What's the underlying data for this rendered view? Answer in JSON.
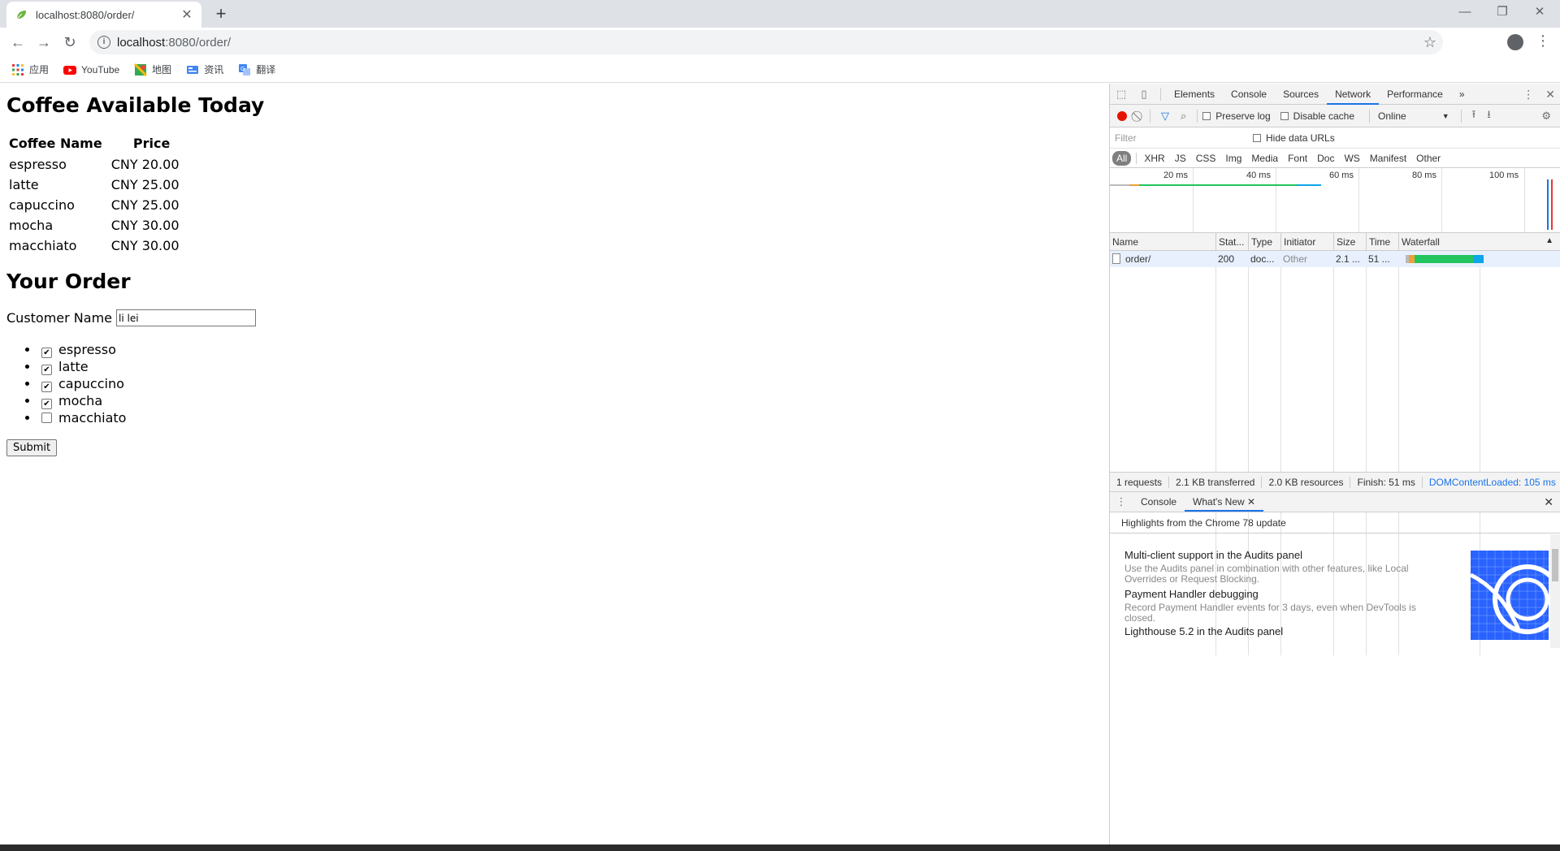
{
  "browser": {
    "tab_title": "localhost:8080/order/",
    "new_tab": "+",
    "url_host": "localhost",
    "url_path": ":8080/order/",
    "bookmarks": [
      {
        "label": "应用",
        "icon": "apps-grid-icon"
      },
      {
        "label": "YouTube",
        "icon": "youtube-icon"
      },
      {
        "label": "地图",
        "icon": "maps-icon"
      },
      {
        "label": "资讯",
        "icon": "news-icon"
      },
      {
        "label": "翻译",
        "icon": "translate-icon"
      }
    ]
  },
  "page": {
    "heading": "Coffee Available Today",
    "table_headers": [
      "Coffee Name",
      "Price"
    ],
    "coffees": [
      {
        "name": "espresso",
        "price": "CNY 20.00"
      },
      {
        "name": "latte",
        "price": "CNY 25.00"
      },
      {
        "name": "capuccino",
        "price": "CNY 25.00"
      },
      {
        "name": "mocha",
        "price": "CNY 30.00"
      },
      {
        "name": "macchiato",
        "price": "CNY 30.00"
      }
    ],
    "order_heading": "Your Order",
    "customer_label": "Customer Name",
    "customer_value": "li lei",
    "order_items": [
      {
        "label": "espresso",
        "checked": true
      },
      {
        "label": "latte",
        "checked": true
      },
      {
        "label": "capuccino",
        "checked": true
      },
      {
        "label": "mocha",
        "checked": true
      },
      {
        "label": "macchiato",
        "checked": false
      }
    ],
    "submit_label": "Submit"
  },
  "devtools": {
    "tabs": [
      "Elements",
      "Console",
      "Sources",
      "Network",
      "Performance"
    ],
    "active_tab": "Network",
    "more": "»",
    "toolbar": {
      "preserve_log": "Preserve log",
      "disable_cache": "Disable cache",
      "throttle": "Online"
    },
    "filter_placeholder": "Filter",
    "hide_data_urls": "Hide data URLs",
    "type_filters": [
      "All",
      "XHR",
      "JS",
      "CSS",
      "Img",
      "Media",
      "Font",
      "Doc",
      "WS",
      "Manifest",
      "Other"
    ],
    "overview_ticks": [
      "20 ms",
      "40 ms",
      "60 ms",
      "80 ms",
      "100 ms"
    ],
    "columns": [
      "Name",
      "Stat...",
      "Type",
      "Initiator",
      "Size",
      "Time",
      "Waterfall"
    ],
    "request": {
      "name": "order/",
      "status": "200",
      "type": "doc...",
      "initiator": "Other",
      "size": "2.1 ...",
      "time": "51 ..."
    },
    "summary": {
      "requests": "1 requests",
      "transferred": "2.1 KB transferred",
      "resources": "2.0 KB resources",
      "finish": "Finish: 51 ms",
      "dcl": "DOMContentLoaded: 105 ms"
    },
    "drawer_tabs": [
      "Console",
      "What's New"
    ],
    "drawer_subtitle": "Highlights from the Chrome 78 update",
    "whats_new": [
      {
        "title": "Multi-client support in the Audits panel",
        "desc": "Use the Audits panel in combination with other features, like Local Overrides or Request Blocking."
      },
      {
        "title": "Payment Handler debugging",
        "desc": "Record Payment Handler events for 3 days, even when DevTools is closed."
      },
      {
        "title": "Lighthouse 5.2 in the Audits panel",
        "desc": ""
      }
    ]
  }
}
